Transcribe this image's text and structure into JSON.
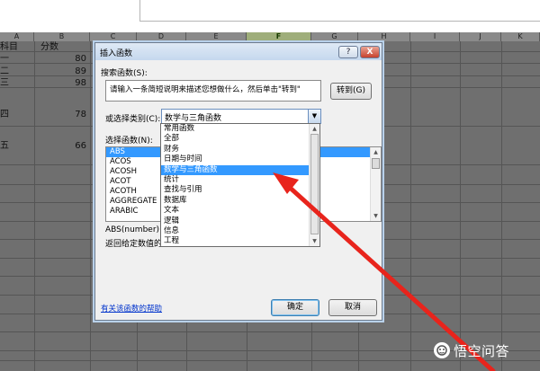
{
  "sheet": {
    "columns": [
      "A",
      "B",
      "C",
      "D",
      "E",
      "F",
      "G",
      "H",
      "I",
      "J",
      "K"
    ],
    "selected_column": "F",
    "cells": {
      "a1": "科目",
      "b1": "分数",
      "a2": "一",
      "b2": "80",
      "a3": "二",
      "b3": "89",
      "a4": "三",
      "b4": "98",
      "a5": "四",
      "b5": "78",
      "a6": "五",
      "b6": "66"
    }
  },
  "dialog": {
    "title": "插入函数",
    "help_label": "?",
    "close_label": "X",
    "search_label": "搜索函数(S):",
    "search_value": "请输入一条简短说明来描述您想做什么，然后单击\"转到\"",
    "goto_label": "转到(G)",
    "category_label": "或选择类别(C):",
    "category_value": "数学与三角函数",
    "select_function_label": "选择函数(N):",
    "functions": [
      "ABS",
      "ACOS",
      "ACOSH",
      "ACOT",
      "ACOTH",
      "AGGREGATE",
      "ARABIC"
    ],
    "selected_function": "ABS",
    "signature": "ABS(number)",
    "description": "返回给定数值的",
    "help_link": "有关该函数的帮助",
    "ok_label": "确定",
    "cancel_label": "取消"
  },
  "category_dropdown": {
    "items": [
      "常用函数",
      "全部",
      "财务",
      "日期与时间",
      "数学与三角函数",
      "统计",
      "查找与引用",
      "数据库",
      "文本",
      "逻辑",
      "信息",
      "工程"
    ],
    "selected": "数学与三角函数"
  },
  "watermark": {
    "text": "悟空问答"
  },
  "colors": {
    "sheet_bg": "#6f6f6f",
    "selection": "#3399ff",
    "arrow": "#e8241c",
    "link": "#0033cc"
  }
}
